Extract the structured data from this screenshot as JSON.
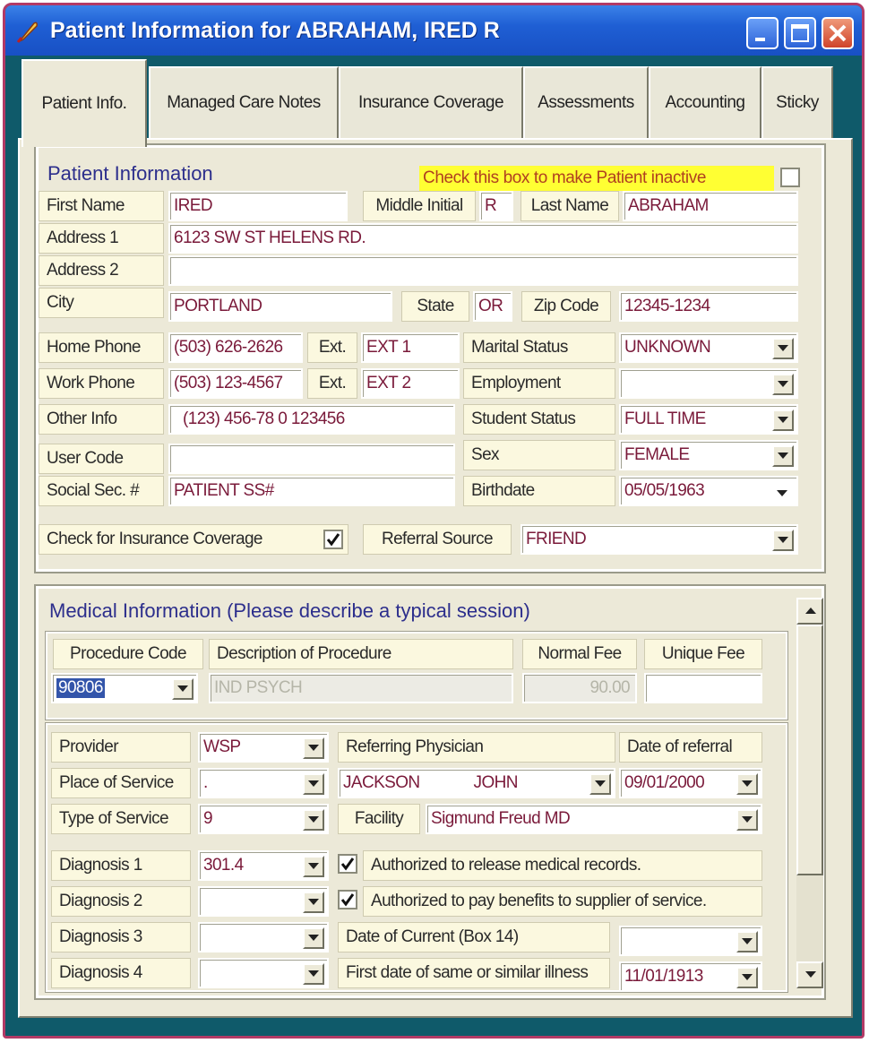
{
  "window": {
    "title": "Patient Information for ABRAHAM, IRED R"
  },
  "tabs": [
    "Patient Info.",
    "Managed Care Notes",
    "Insurance Coverage",
    "Assessments",
    "Accounting",
    "Sticky"
  ],
  "patient": {
    "group_title": "Patient Information",
    "inactive_label": "Check this box to make Patient inactive",
    "inactive_checked": false,
    "labels": {
      "first_name": "First Name",
      "middle_initial": "Middle Initial",
      "last_name": "Last Name",
      "address1": "Address 1",
      "address2": "Address 2",
      "city": "City",
      "state": "State",
      "zip": "Zip Code",
      "home_phone": "Home Phone",
      "work_phone": "Work Phone",
      "ext1": "Ext.",
      "ext2": "Ext.",
      "other_info": "Other Info",
      "user_code": "User Code",
      "ssn": "Social Sec. #",
      "marital_status": "Marital Status",
      "employment": "Employment",
      "student_status": "Student Status",
      "sex": "Sex",
      "birthdate": "Birthdate",
      "insurance_check": "Check for Insurance Coverage",
      "referral_source": "Referral Source"
    },
    "values": {
      "first_name": "IRED",
      "middle_initial": "R",
      "last_name": "ABRAHAM",
      "address1": "6123 SW ST HELENS RD.",
      "address2": "",
      "city": "PORTLAND",
      "state": "OR",
      "zip": "12345-1234",
      "home_phone": "(503) 626-2626",
      "home_ext": "EXT 1",
      "work_phone": "(503) 123-4567",
      "work_ext": "EXT 2",
      "other_info": "(123) 456-78 0 123456",
      "user_code": "",
      "ssn": "PATIENT SS#",
      "marital_status": "UNKNOWN",
      "employment": "",
      "student_status": "FULL TIME",
      "sex": "FEMALE",
      "birthdate": "05/05/1963",
      "insurance_checked": true,
      "referral_source": "FRIEND"
    }
  },
  "medical": {
    "group_title": "Medical Information (Please describe a typical session)",
    "labels": {
      "procedure_code": "Procedure Code",
      "description": "Description of Procedure",
      "normal_fee": "Normal Fee",
      "unique_fee": "Unique Fee",
      "provider": "Provider",
      "referring_physician": "Referring Physician",
      "date_of_referral": "Date of referral",
      "place_of_service": "Place of Service",
      "type_of_service": "Type of Service",
      "facility": "Facility",
      "diagnosis1": "Diagnosis 1",
      "diagnosis2": "Diagnosis 2",
      "diagnosis3": "Diagnosis 3",
      "diagnosis4": "Diagnosis 4",
      "auth_release": "Authorized to release medical records.",
      "auth_pay": "Authorized to pay benefits to supplier of service.",
      "date_current": "Date of Current (Box 14)",
      "first_date": "First date of same or similar illness"
    },
    "values": {
      "procedure_code": "90806",
      "description": "IND PSYCH",
      "normal_fee": "90.00",
      "unique_fee": "",
      "provider": "WSP",
      "physician_last": "JACKSON",
      "physician_first": "JOHN",
      "date_of_referral": "09/01/2000",
      "place_of_service": ".",
      "type_of_service": "9",
      "facility": "Sigmund Freud MD",
      "diagnosis1": "301.4",
      "diagnosis2": "",
      "diagnosis3": "",
      "diagnosis4": "",
      "auth_release_checked": true,
      "auth_pay_checked": true,
      "date_current": "",
      "first_date": "11/01/1913"
    }
  }
}
